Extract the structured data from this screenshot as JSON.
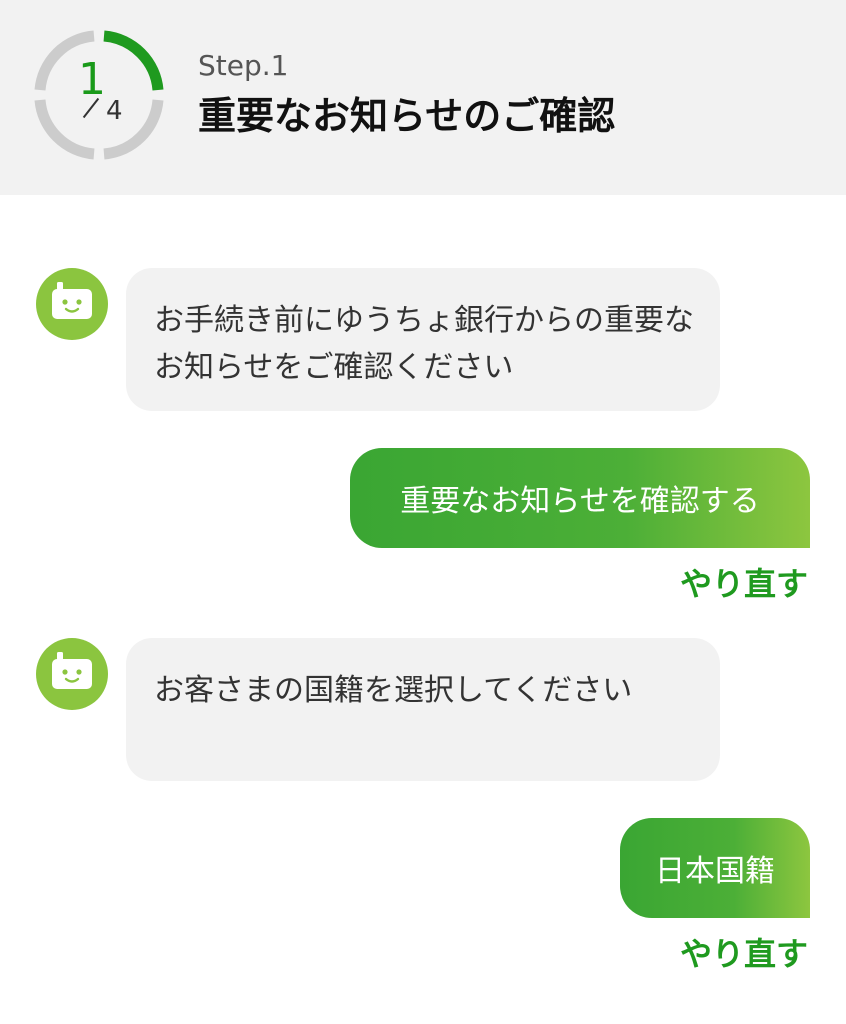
{
  "header": {
    "progress": {
      "current": "1",
      "total": "4"
    },
    "step_label": "Step.1",
    "title": "重要なお知らせのご確認"
  },
  "messages": [
    {
      "from": "bot",
      "text": "お手続き前にゆうちょ銀行からの重要なお知らせをご確認ください"
    },
    {
      "from": "user",
      "text": "重要なお知らせを確認する",
      "redo_label": "やり直す"
    },
    {
      "from": "bot",
      "text": "お客さまの国籍を選択してください"
    },
    {
      "from": "user",
      "text": "日本国籍",
      "redo_label": "やり直す"
    }
  ],
  "icons": {
    "bot": "robot-face-icon"
  },
  "colors": {
    "accent_green": "#1f9a1f",
    "avatar_green": "#8bc53f",
    "bubble_gray": "#f2f2f2",
    "progress_track": "#cccccc"
  }
}
